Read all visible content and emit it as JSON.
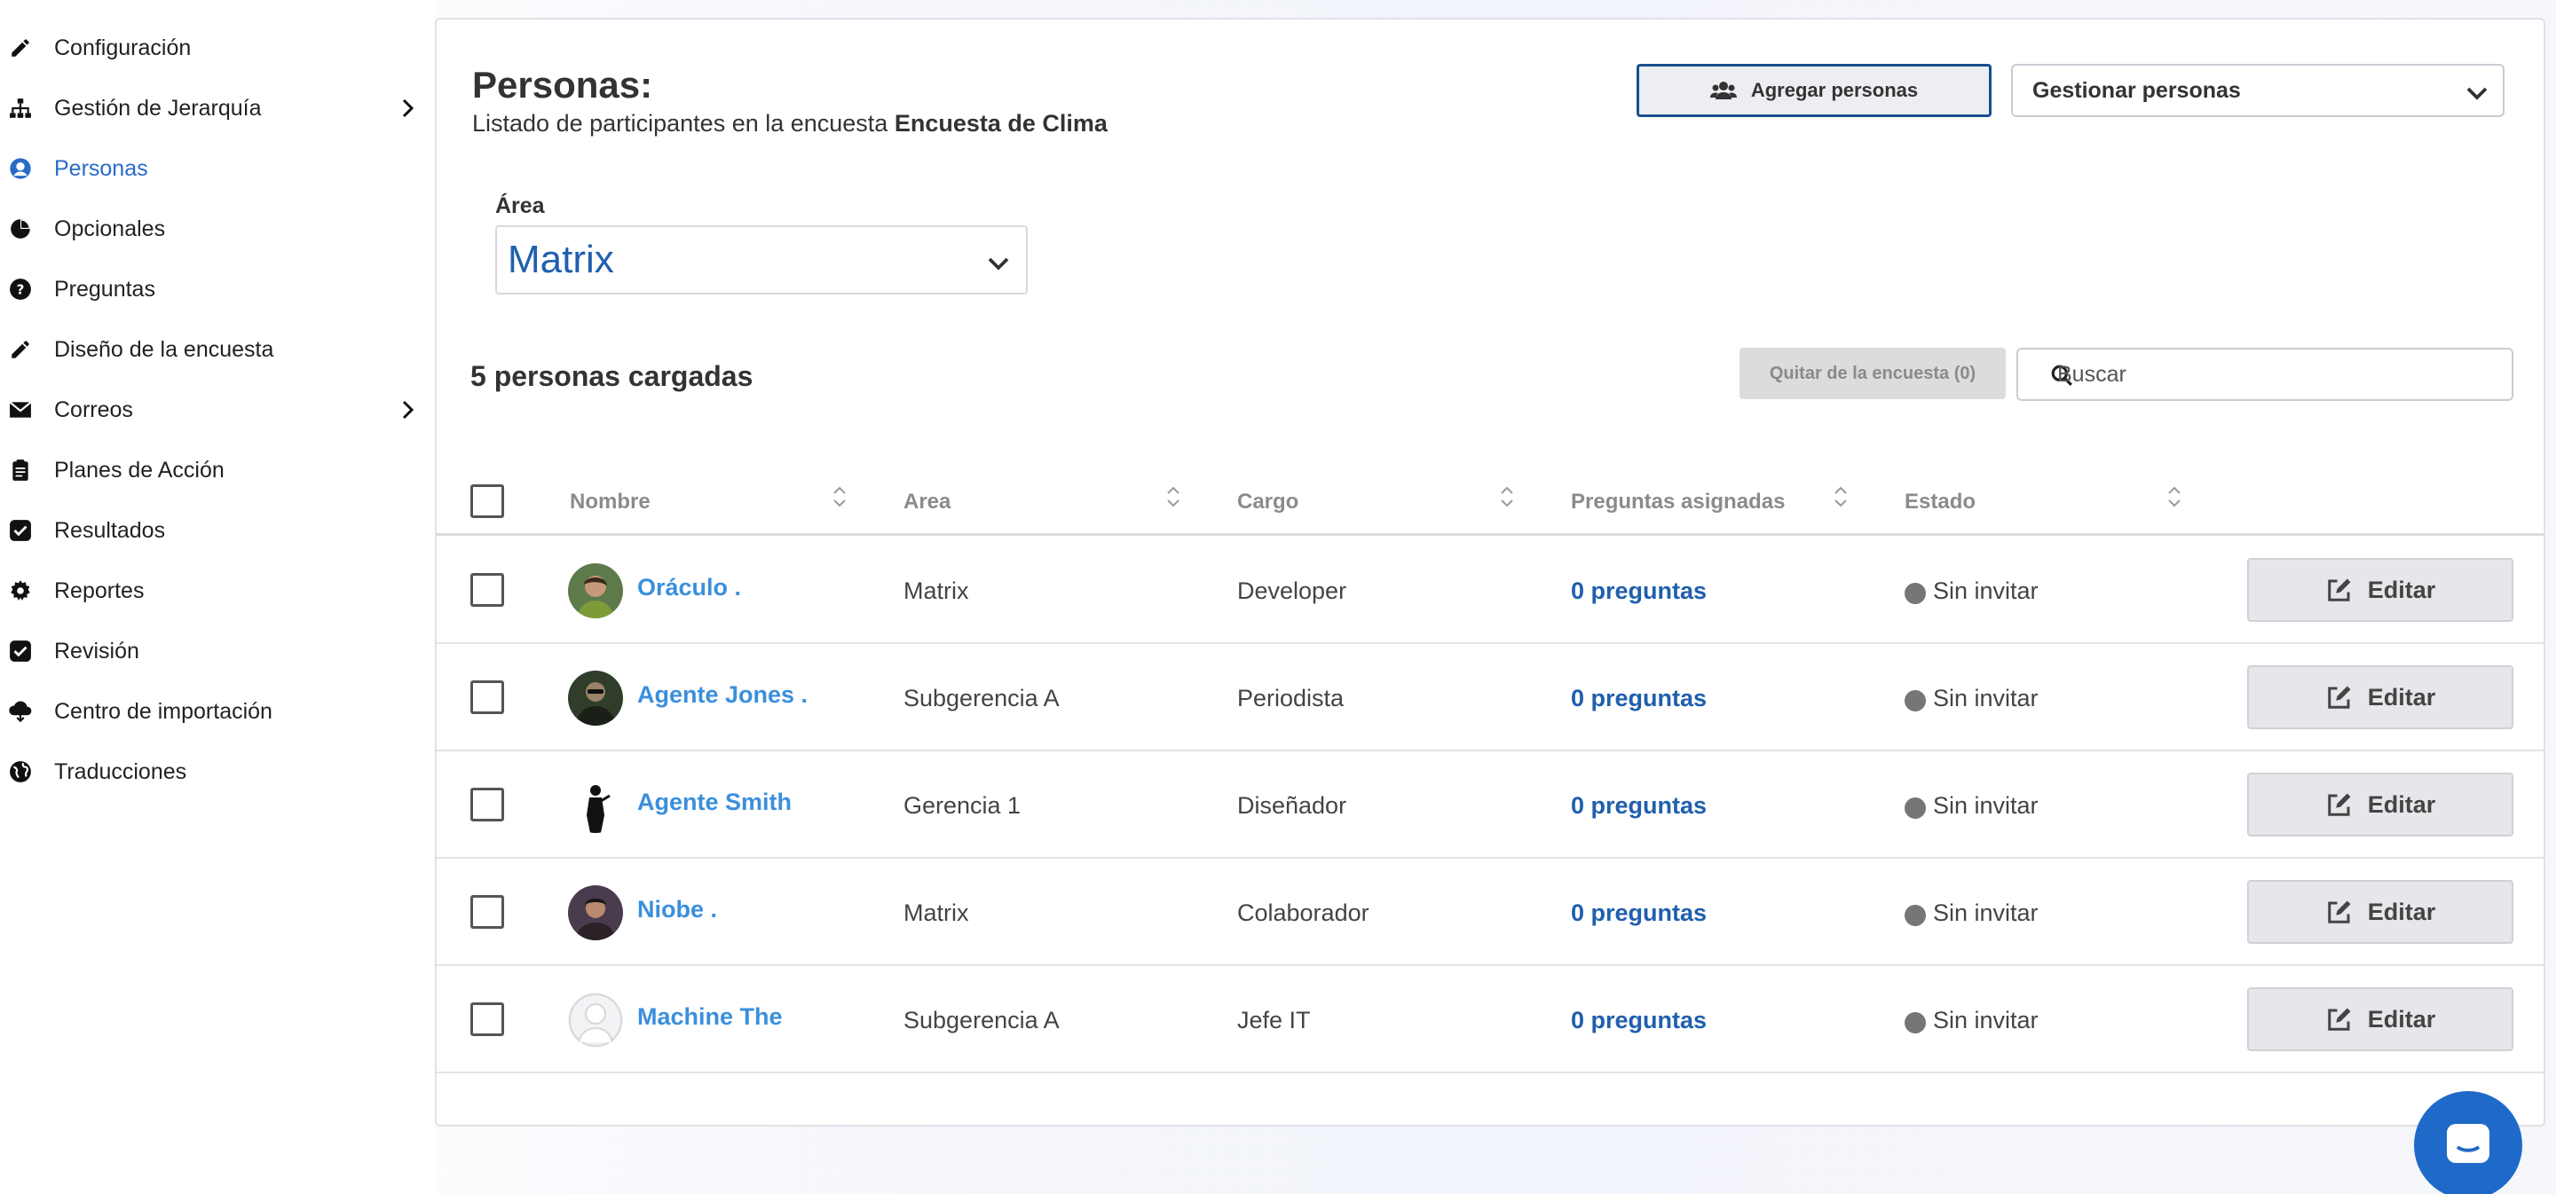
{
  "sidebar": {
    "items": [
      {
        "label": "Configuración",
        "icon": "pencil-icon",
        "has_arrow": false,
        "active": false
      },
      {
        "label": "Gestión de Jerarquía",
        "icon": "hierarchy-icon",
        "has_arrow": true,
        "active": false
      },
      {
        "label": "Personas",
        "icon": "user-icon",
        "has_arrow": false,
        "active": true
      },
      {
        "label": "Opcionales",
        "icon": "pie-chart-icon",
        "has_arrow": false,
        "active": false
      },
      {
        "label": "Preguntas",
        "icon": "question-icon",
        "has_arrow": false,
        "active": false
      },
      {
        "label": "Diseño de la encuesta",
        "icon": "pencil-icon",
        "has_arrow": false,
        "active": false
      },
      {
        "label": "Correos",
        "icon": "envelope-icon",
        "has_arrow": true,
        "active": false
      },
      {
        "label": "Planes de Acción",
        "icon": "clipboard-icon",
        "has_arrow": false,
        "active": false
      },
      {
        "label": "Resultados",
        "icon": "check-square-icon",
        "has_arrow": false,
        "active": false
      },
      {
        "label": "Reportes",
        "icon": "gear-icon",
        "has_arrow": false,
        "active": false
      },
      {
        "label": "Revisión",
        "icon": "check-square-icon",
        "has_arrow": false,
        "active": false
      },
      {
        "label": "Centro de importación",
        "icon": "cloud-download-icon",
        "has_arrow": false,
        "active": false
      },
      {
        "label": "Traducciones",
        "icon": "globe-icon",
        "has_arrow": false,
        "active": false
      }
    ]
  },
  "header": {
    "title": "Personas:",
    "subtitle_prefix": "Listado de participantes en la encuesta ",
    "survey_name": "Encuesta de Clima",
    "add_button": "Agregar personas",
    "manage_select": "Gestionar personas"
  },
  "filter": {
    "label": "Área",
    "value": "Matrix"
  },
  "summary": {
    "count_text": "5 personas cargadas",
    "remove_button": "Quitar de la encuesta (0)",
    "search_placeholder": "Buscar"
  },
  "table": {
    "columns": [
      "Nombre",
      "Area",
      "Cargo",
      "Preguntas asignadas",
      "Estado"
    ],
    "rows": [
      {
        "name": "Oráculo .",
        "area": "Matrix",
        "cargo": "Developer",
        "preguntas": "0 preguntas",
        "estado": "Sin invitar",
        "action": "Editar",
        "avatar": "photo-green"
      },
      {
        "name": "Agente Jones .",
        "area": "Subgerencia A",
        "cargo": "Periodista",
        "preguntas": "0 preguntas",
        "estado": "Sin invitar",
        "action": "Editar",
        "avatar": "photo-dark-green"
      },
      {
        "name": "Agente Smith",
        "area": "Gerencia 1",
        "cargo": "Diseñador",
        "preguntas": "0 preguntas",
        "estado": "Sin invitar",
        "action": "Editar",
        "avatar": "photo-silhouette"
      },
      {
        "name": "Niobe .",
        "area": "Matrix",
        "cargo": "Colaborador",
        "preguntas": "0 preguntas",
        "estado": "Sin invitar",
        "action": "Editar",
        "avatar": "photo-portrait"
      },
      {
        "name": "Machine The",
        "area": "Subgerencia A",
        "cargo": "Jefe IT",
        "preguntas": "0 preguntas",
        "estado": "Sin invitar",
        "action": "Editar",
        "avatar": "placeholder"
      }
    ]
  },
  "colors": {
    "accent": "#2a6bc8",
    "link": "#3a8fdc",
    "dark_link": "#1f5fae",
    "status_gray": "#767676",
    "chat": "#1f69c8"
  },
  "icons": {
    "add_button": "users-icon",
    "edit_button": "edit-icon",
    "search": "search-icon",
    "chat": "chat-icon"
  }
}
